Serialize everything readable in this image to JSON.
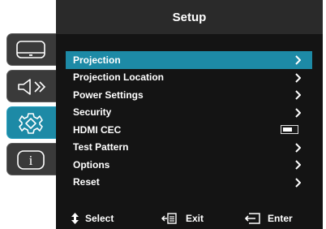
{
  "header": {
    "title": "Setup"
  },
  "tabs": [
    {
      "name": "display",
      "icon": "monitor-icon",
      "active": false
    },
    {
      "name": "audio",
      "icon": "speaker-icon",
      "active": false
    },
    {
      "name": "setup",
      "icon": "gear-icon",
      "active": true
    },
    {
      "name": "info",
      "icon": "info-icon",
      "active": false
    }
  ],
  "menu": {
    "items": [
      {
        "label": "Projection",
        "control": "chevron",
        "selected": true
      },
      {
        "label": "Projection Location",
        "control": "chevron"
      },
      {
        "label": "Power Settings",
        "control": "chevron"
      },
      {
        "label": "Security",
        "control": "chevron"
      },
      {
        "label": "HDMI CEC",
        "control": "toggle",
        "toggle_on": false
      },
      {
        "label": "Test Pattern",
        "control": "chevron"
      },
      {
        "label": "Options",
        "control": "chevron"
      },
      {
        "label": "Reset",
        "control": "chevron"
      }
    ]
  },
  "footer": {
    "select_label": "Select",
    "exit_label": "Exit",
    "enter_label": "Enter"
  },
  "colors": {
    "accent": "#1d8aa6",
    "panel": "#141414",
    "titlebar": "#2a2a2a",
    "tab": "#3a3a3a"
  }
}
